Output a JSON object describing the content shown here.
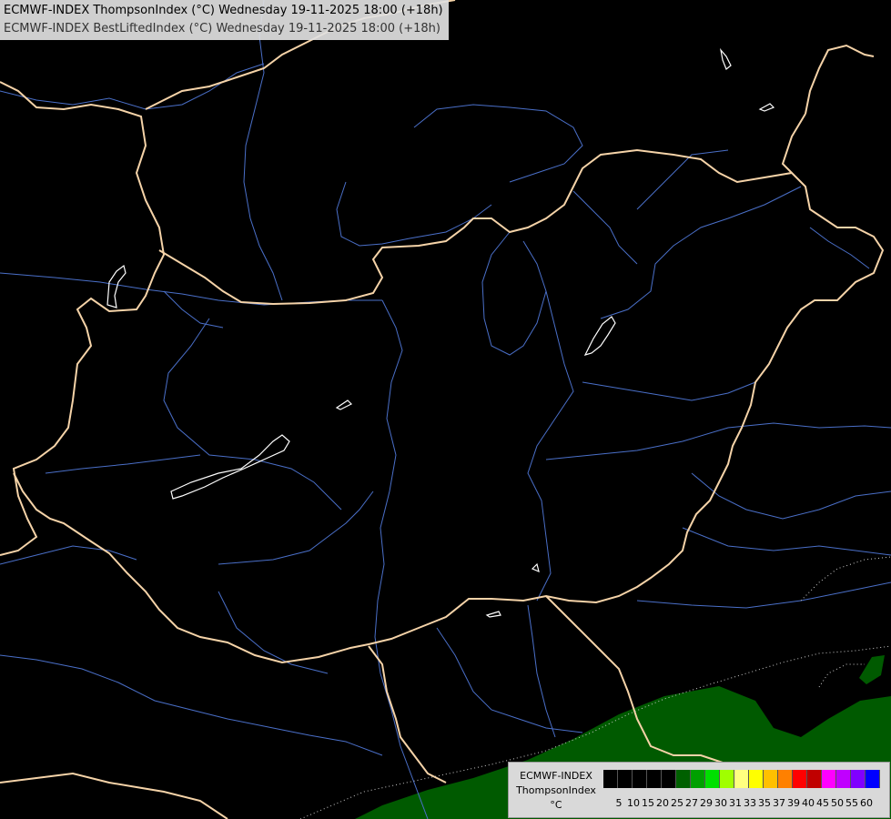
{
  "header": {
    "line1": "ECMWF-INDEX ThompsonIndex (°C) Wednesday 19-11-2025 18:00 (+18h)",
    "line2": "ECMWF-INDEX BestLiftedIndex (°C) Wednesday 19-11-2025 18:00 (+18h)"
  },
  "legend": {
    "line1": "ECMWF-INDEX",
    "line2": "ThompsonIndex",
    "unit": "°C",
    "bins": [
      {
        "value": "",
        "color": "#000000"
      },
      {
        "value": "5",
        "color": "#000000"
      },
      {
        "value": "10",
        "color": "#000000"
      },
      {
        "value": "15",
        "color": "#000000"
      },
      {
        "value": "20",
        "color": "#000000"
      },
      {
        "value": "25",
        "color": "#006000"
      },
      {
        "value": "27",
        "color": "#00a000"
      },
      {
        "value": "29",
        "color": "#00e000"
      },
      {
        "value": "30",
        "color": "#a0ff00"
      },
      {
        "value": "31",
        "color": "#ffff80"
      },
      {
        "value": "33",
        "color": "#ffff00"
      },
      {
        "value": "35",
        "color": "#ffc000"
      },
      {
        "value": "37",
        "color": "#ff8000"
      },
      {
        "value": "39",
        "color": "#ff0000"
      },
      {
        "value": "40",
        "color": "#c00000"
      },
      {
        "value": "45",
        "color": "#ff00ff"
      },
      {
        "value": "50",
        "color": "#c000ff"
      },
      {
        "value": "55",
        "color": "#8000ff"
      },
      {
        "value": "60",
        "color": "#0000ff"
      }
    ]
  },
  "map_colors": {
    "background": "#000000",
    "border": "#f5d3a8",
    "river": "#4a6fc8",
    "lake": "#ffffff",
    "field_green": "#005a00",
    "contour": "#cccccc"
  }
}
